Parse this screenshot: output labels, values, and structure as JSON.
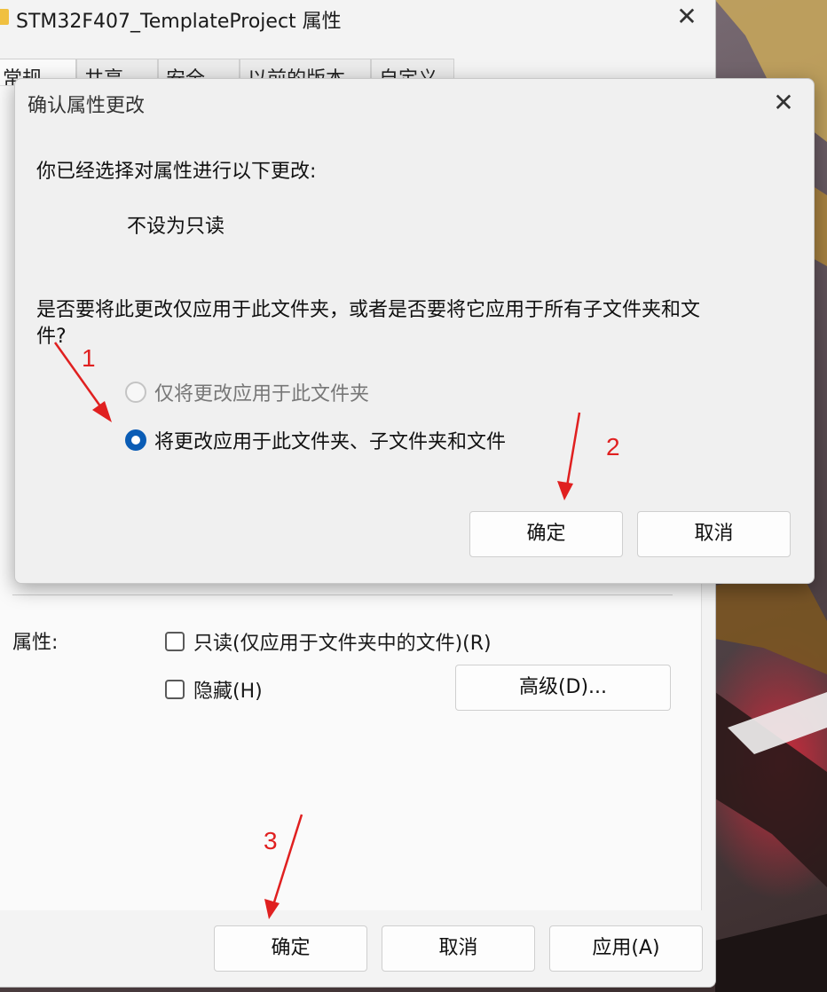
{
  "properties_window": {
    "title": "STM32F407_TemplateProject 属性",
    "tabs": [
      {
        "label": "常规",
        "active": true
      },
      {
        "label": "共享",
        "active": false
      },
      {
        "label": "安全",
        "active": false
      },
      {
        "label": "以前的版本",
        "active": false
      },
      {
        "label": "自定义",
        "active": false
      }
    ],
    "attributes_label": "属性:",
    "readonly_checkbox": {
      "label": "只读(仅应用于文件夹中的文件)(R)",
      "checked": false
    },
    "hidden_checkbox": {
      "label": "隐藏(H)",
      "checked": false
    },
    "advanced_button": "高级(D)...",
    "ok_button": "确定",
    "cancel_button": "取消",
    "apply_button": "应用(A)"
  },
  "confirm_dialog": {
    "title": "确认属性更改",
    "intro": "你已经选择对属性进行以下更改:",
    "change": "不设为只读",
    "question_line1": "是否要将此更改仅应用于此文件夹，或者是否要将它应用于所有子文件夹和文",
    "question_line2": "件?",
    "option_this_folder": {
      "label": "仅将更改应用于此文件夹",
      "selected": false
    },
    "option_all": {
      "label": "将更改应用于此文件夹、子文件夹和文件",
      "selected": true
    },
    "ok_button": "确定",
    "cancel_button": "取消"
  },
  "annotations": {
    "step1": "1",
    "step2": "2",
    "step3": "3",
    "color": "#e02020"
  },
  "colors": {
    "accent": "#0a5cb5",
    "annotation_red": "#e02020"
  }
}
